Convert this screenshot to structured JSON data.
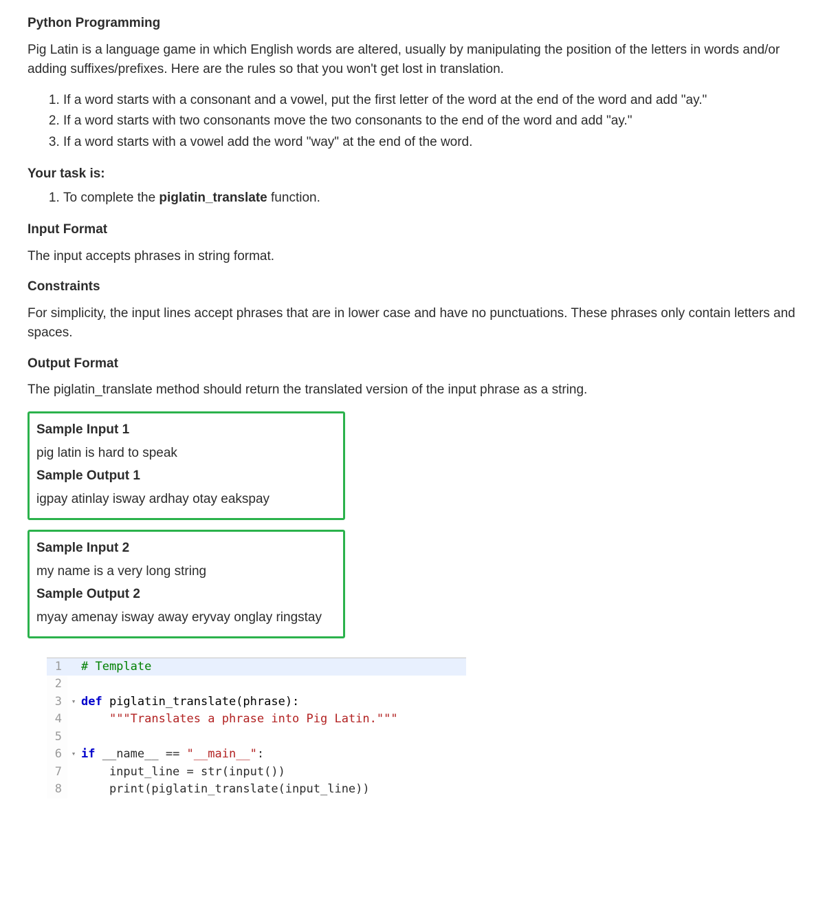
{
  "title": "Python Programming",
  "intro": "Pig Latin is a language game in which English words are altered, usually by manipulating the position of the letters in words and/or adding suffixes/prefixes. Here are the rules so that you won't get lost in translation.",
  "rules": [
    "If a word starts with a consonant and a vowel, put the first letter of the word at the end of the word and add \"ay.\"",
    "If a word starts with two consonants move the two consonants to the end of the word and add \"ay.\"",
    "If a word starts with a vowel add the word \"way\" at the end of the word."
  ],
  "task_heading": "Your task is:",
  "task_prefix": "To complete the ",
  "task_funcname": "piglatin_translate",
  "task_suffix": " function.",
  "input_format_heading": "Input Format",
  "input_format_text": "The input accepts phrases in string format.",
  "constraints_heading": "Constraints",
  "constraints_text": "For simplicity, the input lines accept phrases that are in lower case and have no punctuations. These phrases only contain letters and spaces.",
  "output_format_heading": "Output Format",
  "output_format_text": "The piglatin_translate method should return the translated version of the input phrase as a string.",
  "sample1": {
    "input_heading": "Sample Input 1",
    "input_text": "pig latin is hard to speak",
    "output_heading": "Sample Output 1",
    "output_text": "igpay atinlay isway ardhay otay eakspay"
  },
  "sample2": {
    "input_heading": "Sample Input 2",
    "input_text": "my name is a very long string",
    "output_heading": "Sample Output 2",
    "output_text": "myay amenay isway away eryvay onglay ringstay"
  },
  "code": {
    "line1_comment": "# Template",
    "line3_def": "def",
    "line3_rest": " piglatin_translate(phrase):",
    "line4_docstring": "\"\"\"Translates a phrase into Pig Latin.\"\"\"",
    "line6_if": "if",
    "line6_rest": " __name__ == ",
    "line6_str": "\"__main__\"",
    "line6_colon": ":",
    "line7": "    input_line = str(input())",
    "line8": "    print(piglatin_translate(input_line))"
  }
}
